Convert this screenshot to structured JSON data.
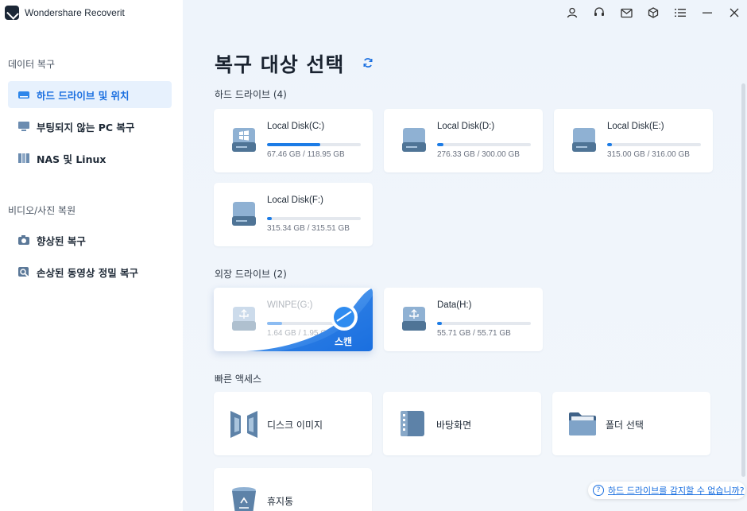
{
  "app": {
    "name": "Wondershare Recoverit"
  },
  "sidebar": {
    "section_data": "데이터 복구",
    "items_data": [
      {
        "label": "하드 드라이브 및 위치",
        "icon": "drive-icon",
        "active": true
      },
      {
        "label": "부팅되지 않는 PC 복구",
        "icon": "monitor-icon",
        "active": false
      },
      {
        "label": "NAS 및 Linux",
        "icon": "nas-icon",
        "active": false
      }
    ],
    "section_media": "비디오/사진 복원",
    "items_media": [
      {
        "label": "향상된 복구",
        "icon": "camera-icon",
        "active": false
      },
      {
        "label": "손상된 동영상 정밀 복구",
        "icon": "video-repair-icon",
        "active": false
      }
    ]
  },
  "topbar": {
    "icons": [
      "user-icon",
      "headset-icon",
      "mail-icon",
      "box-icon",
      "menu-icon",
      "minimize-icon",
      "close-icon"
    ]
  },
  "main": {
    "title": "복구 대상 선택",
    "hard_drives": {
      "label": "하드 드라이브 (4)",
      "items": [
        {
          "name": "Local Disk(C:)",
          "size": "67.46 GB / 118.95 GB",
          "used": 0.567,
          "system": true
        },
        {
          "name": "Local Disk(D:)",
          "size": "276.33 GB / 300.00 GB",
          "used": 0.07
        },
        {
          "name": "Local Disk(E:)",
          "size": "315.00 GB / 316.00 GB",
          "used": 0.05
        },
        {
          "name": "Local Disk(F:)",
          "size": "315.34 GB / 315.51 GB",
          "used": 0.05
        }
      ]
    },
    "external_drives": {
      "label": "외장 드라이브 (2)",
      "items": [
        {
          "name": "WINPE(G:)",
          "size": "1.64 GB / 1.95 GB",
          "used": 0.16,
          "scan_label": "스캔"
        },
        {
          "name": "Data(H:)",
          "size": "55.71 GB / 55.71 GB",
          "used": 0.05
        }
      ]
    },
    "quick_access": {
      "label": "빠른 액세스",
      "items": [
        {
          "label": "디스크 이미지",
          "icon": "disk-image-icon"
        },
        {
          "label": "바탕화면",
          "icon": "desktop-icon"
        },
        {
          "label": "폴더 선택",
          "icon": "folder-icon"
        },
        {
          "label": "휴지통",
          "icon": "recycle-bin-icon"
        }
      ]
    },
    "help_link": "하드 드라이브를 감지할 수 없습니까?"
  },
  "colors": {
    "accent": "#1a6fe0",
    "bar_fill": "#1c7ce6",
    "sidebar_active_bg": "#e7f1fd",
    "main_bg": "#eef4fb"
  }
}
